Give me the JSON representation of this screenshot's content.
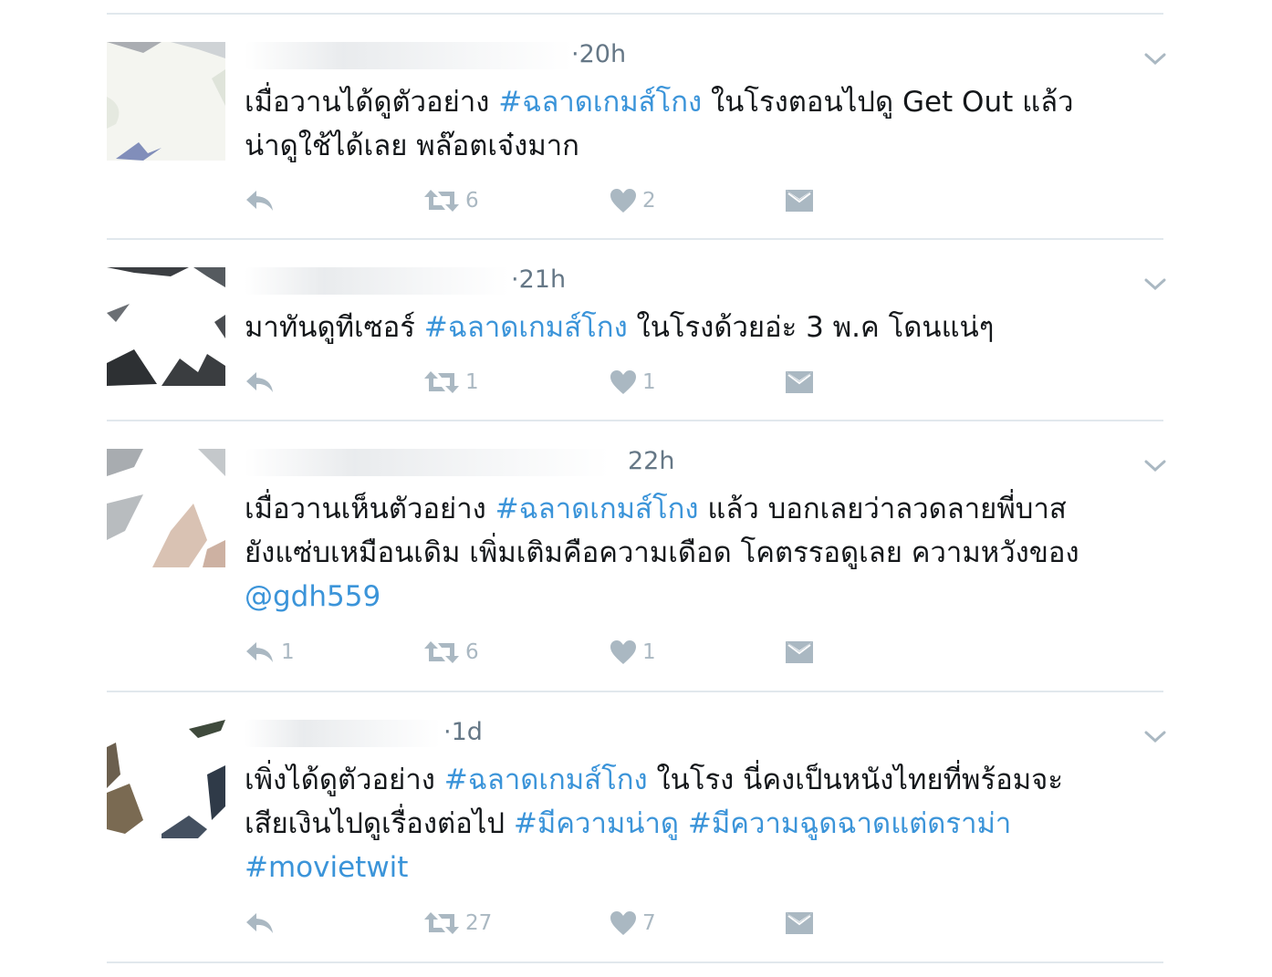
{
  "tweets": [
    {
      "time": "·20h",
      "lines": [
        [
          {
            "t": "เมื่อวานได้ดูตัวอย่าง "
          },
          {
            "t": "#ฉลาดเกมส์โกง",
            "tag": true
          },
          {
            "t": " ในโรงตอนไปดู Get Out แล้ว"
          }
        ],
        [
          {
            "t": "น่าดูใช้ได้เลย พล๊อตเจ๋งมาก"
          }
        ]
      ],
      "reply_count": "",
      "retweet_count": "6",
      "like_count": "2"
    },
    {
      "time": "·21h",
      "lines": [
        [
          {
            "t": "มาทันดูทีเซอร์ "
          },
          {
            "t": "#ฉลาดเกมส์โกง",
            "tag": true
          },
          {
            "t": " ในโรงด้วยอ่ะ 3 พ.ค โดนแน่ๆ"
          }
        ]
      ],
      "reply_count": "",
      "retweet_count": "1",
      "like_count": "1"
    },
    {
      "time": "22h",
      "lines": [
        [
          {
            "t": "เมื่อวานเห็นตัวอย่าง "
          },
          {
            "t": "#ฉลาดเกมส์โกง",
            "tag": true
          },
          {
            "t": " แล้ว บอกเลยว่าลวดลายพี่บาส"
          }
        ],
        [
          {
            "t": "ยังแซ่บเหมือนเดิม เพิ่มเติมคือความเดือด โคตรรอดูเลย ความหวังของ"
          }
        ],
        [
          {
            "t": "@gdh559",
            "tag": true
          }
        ]
      ],
      "reply_count": "1",
      "retweet_count": "6",
      "like_count": "1"
    },
    {
      "time": "·1d",
      "lines": [
        [
          {
            "t": "เพิ่งได้ดูตัวอย่าง "
          },
          {
            "t": "#ฉลาดเกมส์โกง",
            "tag": true
          },
          {
            "t": " ในโรง นี่คงเป็นหนังไทยที่พร้อมจะ"
          }
        ],
        [
          {
            "t": "เสียเงินไปดูเรื่องต่อไป "
          },
          {
            "t": "#มีความน่าดู",
            "tag": true
          },
          {
            "t": " "
          },
          {
            "t": "#มีความฉูดฉาดแต่ดราม่า",
            "tag": true
          }
        ],
        [
          {
            "t": "#movietwit",
            "tag": true
          }
        ]
      ],
      "reply_count": "",
      "retweet_count": "27",
      "like_count": "7"
    }
  ],
  "colors": {
    "hashtag": "#3b94d9",
    "text": "#14171a",
    "meta": "#657786",
    "action": "#aab8c2",
    "divider": "#e1e8ed"
  },
  "icons": {
    "reply": "reply-icon",
    "retweet": "retweet-icon",
    "like": "heart-icon",
    "dm": "envelope-icon",
    "more": "chevron-down-icon"
  }
}
